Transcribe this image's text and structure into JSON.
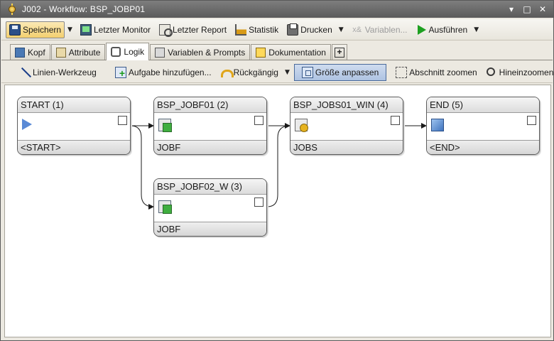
{
  "window": {
    "title": "J002 - Workflow: BSP_JOBP01",
    "controls": [
      "▾",
      "□",
      "✕"
    ]
  },
  "toolbar": {
    "save": "Speichern",
    "last_monitor": "Letzter Monitor",
    "last_report": "Letzter Report",
    "statistics": "Statistik",
    "print": "Drucken",
    "variables": "Variablen...",
    "execute": "Ausführen"
  },
  "tabs": [
    {
      "label": "Kopf",
      "icon": "header-icon"
    },
    {
      "label": "Attribute",
      "icon": "attributes-icon"
    },
    {
      "label": "Logik",
      "icon": "logic-icon",
      "active": true
    },
    {
      "label": "Variablen & Prompts",
      "icon": "variables-icon"
    },
    {
      "label": "Dokumentation",
      "icon": "documentation-icon"
    }
  ],
  "logic_toolbar": {
    "line_tool": "Linien-Werkzeug",
    "add_task": "Aufgabe hinzufügen...",
    "undo": "Rückgängig",
    "fit_size": "Größe anpassen",
    "zoom_section": "Abschnitt zoomen",
    "zoom_in": "Hineinzoomen",
    "more": ">>"
  },
  "nodes": [
    {
      "id": "start",
      "title": "START (1)",
      "type": "<START>",
      "icon": "start-play-icon"
    },
    {
      "id": "jobf01",
      "title": "BSP_JOBF01 (2)",
      "type": "JOBF",
      "icon": "file-transfer-job-icon"
    },
    {
      "id": "jobs01",
      "title": "BSP_JOBS01_WIN (4)",
      "type": "JOBS",
      "icon": "job-gear-icon"
    },
    {
      "id": "end",
      "title": "END (5)",
      "type": "<END>",
      "icon": "end-icon"
    },
    {
      "id": "jobf02",
      "title": "BSP_JOBF02_W (3)",
      "type": "JOBF",
      "icon": "file-transfer-job-icon"
    }
  ],
  "colors": {
    "selected_button": "#aec3e2",
    "save_pressed": "#f3cf6e",
    "titlebar": "#5a5a5a"
  }
}
